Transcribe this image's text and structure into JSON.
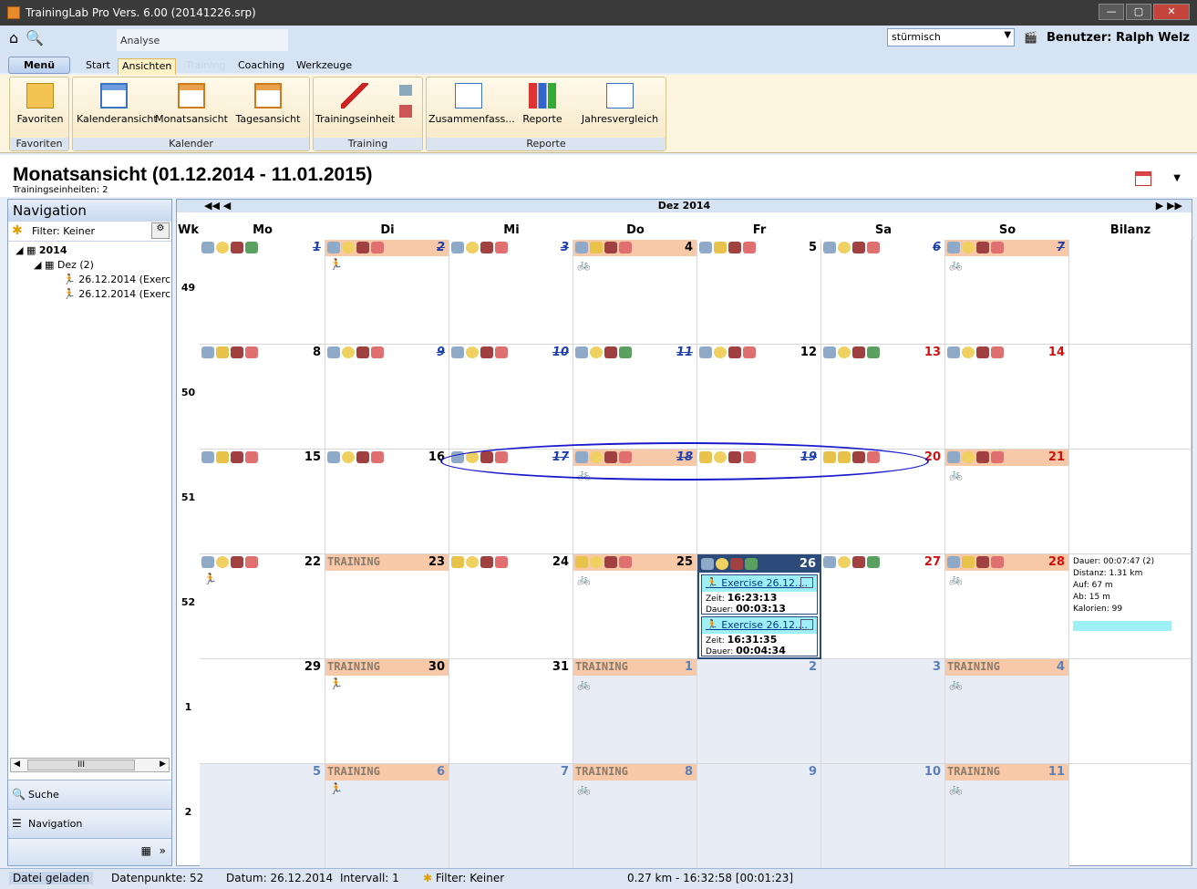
{
  "window": {
    "title": "TrainingLab Pro Vers. 6.00 (20141226.srp)"
  },
  "ribbon": {
    "context_tab": "Analyse",
    "menu_label": "Menü",
    "tabs": [
      "Start",
      "Ansichten",
      "Training",
      "Coaching",
      "Werkzeuge"
    ],
    "weather_select": "stürmisch",
    "user": "Benutzer: Ralph Welz",
    "groups": [
      {
        "label": "Favoriten",
        "buttons": [
          "Favoriten"
        ]
      },
      {
        "label": "Kalender",
        "buttons": [
          "Kalenderansicht",
          "Monatsansicht",
          "Tagesansicht"
        ]
      },
      {
        "label": "Training",
        "buttons": [
          "Trainingseinheit"
        ]
      },
      {
        "label": "Reporte",
        "buttons": [
          "Zusammenfass...",
          "Reporte",
          "Jahresvergleich"
        ]
      }
    ]
  },
  "header": {
    "title": "Monatsansicht (01.12.2014 - 11.01.2015)",
    "subtitle": "Trainingseinheiten: 2"
  },
  "navigation": {
    "title": "Navigation",
    "filter": "Filter: Keiner",
    "tree": [
      "2014",
      "Dez (2)",
      "26.12.2014 (Exercis",
      "26.12.2014 (Exercis"
    ],
    "scroll_label": "III",
    "panes": [
      "Suche",
      "Navigation"
    ]
  },
  "calendar": {
    "month": "Dez 2014",
    "columns": [
      "Wk",
      "Mo",
      "Di",
      "Mi",
      "Do",
      "Fr",
      "Sa",
      "So",
      "Bilanz"
    ],
    "weeks": [
      {
        "wk": "49",
        "days": [
          {
            "d": "1",
            "style": "blue",
            "icons": [
              "cloud",
              "face",
              "flag",
              "hgreen"
            ]
          },
          {
            "d": "2",
            "style": "blue",
            "hl": true,
            "icons": [
              "cloud",
              "face",
              "flag",
              "heart"
            ],
            "act": "run"
          },
          {
            "d": "3",
            "style": "blue",
            "icons": [
              "cloud",
              "face",
              "flag",
              "heart"
            ]
          },
          {
            "d": "4",
            "hl": true,
            "icons": [
              "cloud",
              "sun",
              "flag",
              "heart"
            ],
            "act": "bike"
          },
          {
            "d": "5",
            "icons": [
              "cloud",
              "sun",
              "flag",
              "heart"
            ]
          },
          {
            "d": "6",
            "style": "blue",
            "icons": [
              "cloud",
              "face",
              "flag",
              "heart"
            ]
          },
          {
            "d": "7",
            "style": "blue",
            "hl": true,
            "icons": [
              "cloud",
              "face",
              "flag",
              "heart"
            ],
            "act": "bike"
          }
        ]
      },
      {
        "wk": "50",
        "days": [
          {
            "d": "8",
            "icons": [
              "cloud",
              "sun",
              "flag",
              "heart"
            ]
          },
          {
            "d": "9",
            "style": "blue",
            "icons": [
              "cloud",
              "face",
              "flag",
              "heart"
            ]
          },
          {
            "d": "10",
            "style": "blue",
            "icons": [
              "cloud",
              "face",
              "flag",
              "heart"
            ]
          },
          {
            "d": "11",
            "style": "blue",
            "icons": [
              "cloud",
              "face",
              "flag",
              "hgreen"
            ]
          },
          {
            "d": "12",
            "icons": [
              "cloud",
              "face",
              "flag",
              "heart"
            ]
          },
          {
            "d": "13",
            "style": "red",
            "icons": [
              "cloud",
              "face",
              "flag",
              "hgreen"
            ]
          },
          {
            "d": "14",
            "style": "red",
            "icons": [
              "cloud",
              "face",
              "flag",
              "heart"
            ]
          }
        ]
      },
      {
        "wk": "51",
        "days": [
          {
            "d": "15",
            "icons": [
              "cloud",
              "sun",
              "flag",
              "heart"
            ]
          },
          {
            "d": "16",
            "icons": [
              "cloud",
              "face",
              "flag",
              "heart"
            ]
          },
          {
            "d": "17",
            "style": "blue",
            "icons": [
              "cloud",
              "face",
              "flag",
              "heart"
            ]
          },
          {
            "d": "18",
            "style": "blue",
            "hl": true,
            "icons": [
              "cloud",
              "face",
              "flag",
              "heart"
            ],
            "act": "bike"
          },
          {
            "d": "19",
            "style": "blue",
            "icons": [
              "sun",
              "face",
              "flag",
              "heart"
            ]
          },
          {
            "d": "20",
            "style": "red",
            "icons": [
              "sun",
              "sun",
              "flag",
              "heart"
            ]
          },
          {
            "d": "21",
            "style": "red",
            "hl": true,
            "icons": [
              "cloud",
              "face",
              "flag",
              "heart"
            ],
            "act": "bike"
          }
        ]
      },
      {
        "wk": "52",
        "days": [
          {
            "d": "22",
            "icons": [
              "cloud",
              "face",
              "flag",
              "heart"
            ],
            "act": "run"
          },
          {
            "d": "23",
            "hl": true,
            "training": "TRAINING"
          },
          {
            "d": "24",
            "icons": [
              "sun",
              "face",
              "flag",
              "heart"
            ]
          },
          {
            "d": "25",
            "hl": true,
            "icons": [
              "sun",
              "face",
              "flag",
              "heart"
            ],
            "act": "bike"
          },
          {
            "d": "26",
            "sel": true,
            "icons": [
              "cloud",
              "face",
              "flag",
              "hgreen"
            ],
            "exercises": [
              {
                "title": "Exercise 26.12....",
                "zeit_label": "Zeit:",
                "zeit": "16:23:13",
                "dauer_label": "Dauer:",
                "dauer": "00:03:13"
              },
              {
                "title": "Exercise 26.12....",
                "zeit_label": "Zeit:",
                "zeit": "16:31:35",
                "dauer_label": "Dauer:",
                "dauer": "00:04:34"
              }
            ]
          },
          {
            "d": "27",
            "style": "red",
            "icons": [
              "cloud",
              "face",
              "flag",
              "hgreen"
            ]
          },
          {
            "d": "28",
            "style": "red",
            "hl": true,
            "icons": [
              "cloud",
              "sun",
              "flag",
              "heart"
            ],
            "act": "bike"
          }
        ],
        "bilanz": [
          "Dauer: 00:07:47 (2)",
          "Distanz: 1.31 km",
          "Auf: 67 m",
          "Ab: 15 m",
          "Kalorien: 99"
        ]
      },
      {
        "wk": "1",
        "days": [
          {
            "d": "29"
          },
          {
            "d": "30",
            "hl": true,
            "training": "TRAINING",
            "act": "run"
          },
          {
            "d": "31"
          },
          {
            "d": "1",
            "style": "grey",
            "out": true,
            "hl": true,
            "training": "TRAINING",
            "act": "bike"
          },
          {
            "d": "2",
            "style": "grey",
            "out": true
          },
          {
            "d": "3",
            "style": "grey",
            "out": true
          },
          {
            "d": "4",
            "style": "grey",
            "out": true,
            "hl": true,
            "training": "TRAINING",
            "act": "bike"
          }
        ]
      },
      {
        "wk": "2",
        "days": [
          {
            "d": "5",
            "style": "grey",
            "out": true
          },
          {
            "d": "6",
            "style": "grey",
            "out": true,
            "hl": true,
            "training": "TRAINING",
            "act": "run"
          },
          {
            "d": "7",
            "style": "grey",
            "out": true
          },
          {
            "d": "8",
            "style": "grey",
            "out": true,
            "hl": true,
            "training": "TRAINING",
            "act": "bike"
          },
          {
            "d": "9",
            "style": "grey",
            "out": true
          },
          {
            "d": "10",
            "style": "grey",
            "out": true
          },
          {
            "d": "11",
            "style": "grey",
            "out": true,
            "hl": true,
            "training": "TRAINING",
            "act": "bike"
          }
        ]
      }
    ]
  },
  "statusbar": {
    "file": "Datei geladen",
    "points": "Datenpunkte: 52",
    "date": "Datum: 26.12.2014",
    "interval": "Intervall: 1",
    "filter": "Filter: Keiner",
    "position": "0.27 km - 16:32:58 [00:01:23]"
  }
}
